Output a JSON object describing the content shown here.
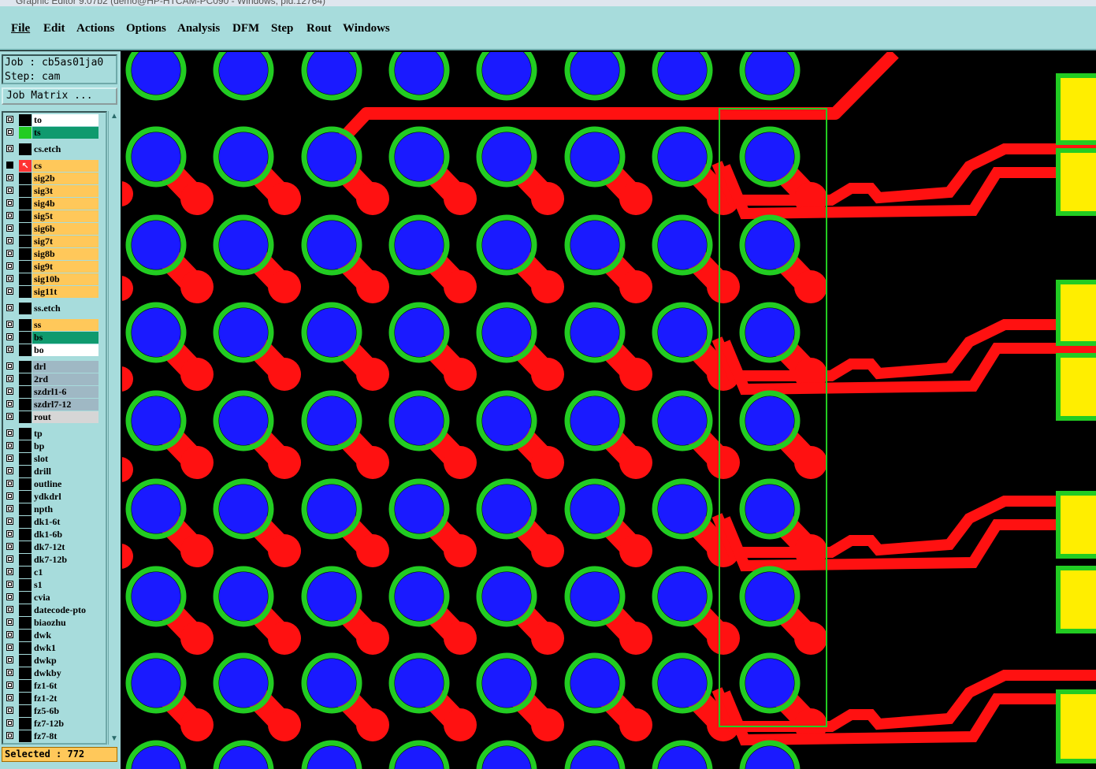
{
  "window": {
    "title": "Graphic Editor 9.07b2 (demo@HP-HTCAM-PC090 - Windows, pid:12764)"
  },
  "menu": [
    "File",
    "Edit",
    "Actions",
    "Options",
    "Analysis",
    "DFM",
    "Step",
    "Rout",
    "Windows"
  ],
  "job": {
    "line": "Job : cb5as01ja0",
    "step_line": "Step: cam",
    "matrix_button": "Job Matrix ..."
  },
  "layers": [
    {
      "name": "to",
      "color": "#ffffff",
      "swatch": "#000000"
    },
    {
      "name": "ts",
      "color": "#0f9a6e",
      "swatch": "#22cc22"
    },
    {
      "name": "cs.etch",
      "color": "#a7dcdc",
      "swatch": "#000000",
      "gap": true
    },
    {
      "name": "cs",
      "color": "#ffc85a",
      "swatch": "#ff3333",
      "active": true,
      "gap": true
    },
    {
      "name": "sig2b",
      "color": "#ffc85a",
      "swatch": "#000000"
    },
    {
      "name": "sig3t",
      "color": "#ffc85a",
      "swatch": "#000000"
    },
    {
      "name": "sig4b",
      "color": "#ffc85a",
      "swatch": "#000000"
    },
    {
      "name": "sig5t",
      "color": "#ffc85a",
      "swatch": "#000000"
    },
    {
      "name": "sig6b",
      "color": "#ffc85a",
      "swatch": "#000000"
    },
    {
      "name": "sig7t",
      "color": "#ffc85a",
      "swatch": "#000000"
    },
    {
      "name": "sig8b",
      "color": "#ffc85a",
      "swatch": "#000000"
    },
    {
      "name": "sig9t",
      "color": "#ffc85a",
      "swatch": "#000000"
    },
    {
      "name": "sig10b",
      "color": "#ffc85a",
      "swatch": "#000000"
    },
    {
      "name": "sig11t",
      "color": "#ffc85a",
      "swatch": "#000000"
    },
    {
      "name": "ss.etch",
      "color": "#a7dcdc",
      "swatch": "#000000",
      "gap": true
    },
    {
      "name": "ss",
      "color": "#ffc85a",
      "swatch": "#000000",
      "gap": true
    },
    {
      "name": "bs",
      "color": "#0f9a6e",
      "swatch": "#000000"
    },
    {
      "name": "bo",
      "color": "#ffffff",
      "swatch": "#000000"
    },
    {
      "name": "drl",
      "color": "#9fb8c4",
      "swatch": "#000000",
      "gap": true
    },
    {
      "name": "2rd",
      "color": "#9fb8c4",
      "swatch": "#000000"
    },
    {
      "name": "szdrl1-6",
      "color": "#9fb8c4",
      "swatch": "#000000"
    },
    {
      "name": "szdrl7-12",
      "color": "#9fb8c4",
      "swatch": "#000000"
    },
    {
      "name": "rout",
      "color": "#d6d6d6",
      "swatch": "#000000"
    },
    {
      "name": "tp",
      "color": "#a7dcdc",
      "swatch": "#000000",
      "gap": true
    },
    {
      "name": "bp",
      "color": "#a7dcdc",
      "swatch": "#000000"
    },
    {
      "name": "slot",
      "color": "#a7dcdc",
      "swatch": "#000000"
    },
    {
      "name": "drill",
      "color": "#a7dcdc",
      "swatch": "#000000"
    },
    {
      "name": "outline",
      "color": "#a7dcdc",
      "swatch": "#000000"
    },
    {
      "name": "ydkdrl",
      "color": "#a7dcdc",
      "swatch": "#000000"
    },
    {
      "name": "npth",
      "color": "#a7dcdc",
      "swatch": "#000000"
    },
    {
      "name": "dk1-6t",
      "color": "#a7dcdc",
      "swatch": "#000000"
    },
    {
      "name": "dk1-6b",
      "color": "#a7dcdc",
      "swatch": "#000000"
    },
    {
      "name": "dk7-12t",
      "color": "#a7dcdc",
      "swatch": "#000000"
    },
    {
      "name": "dk7-12b",
      "color": "#a7dcdc",
      "swatch": "#000000"
    },
    {
      "name": "c1",
      "color": "#a7dcdc",
      "swatch": "#000000"
    },
    {
      "name": "s1",
      "color": "#a7dcdc",
      "swatch": "#000000"
    },
    {
      "name": "cvia",
      "color": "#a7dcdc",
      "swatch": "#000000"
    },
    {
      "name": "datecode-pto",
      "color": "#a7dcdc",
      "swatch": "#000000"
    },
    {
      "name": "biaozhu",
      "color": "#a7dcdc",
      "swatch": "#000000"
    },
    {
      "name": "dwk",
      "color": "#a7dcdc",
      "swatch": "#000000"
    },
    {
      "name": "dwk1",
      "color": "#a7dcdc",
      "swatch": "#000000"
    },
    {
      "name": "dwkp",
      "color": "#a7dcdc",
      "swatch": "#000000"
    },
    {
      "name": "dwkby",
      "color": "#a7dcdc",
      "swatch": "#000000"
    },
    {
      "name": "fz1-6t",
      "color": "#a7dcdc",
      "swatch": "#000000"
    },
    {
      "name": "fz1-2t",
      "color": "#a7dcdc",
      "swatch": "#000000"
    },
    {
      "name": "fz5-6b",
      "color": "#a7dcdc",
      "swatch": "#000000"
    },
    {
      "name": "fz7-12b",
      "color": "#a7dcdc",
      "swatch": "#000000"
    },
    {
      "name": "fz7-8t",
      "color": "#a7dcdc",
      "swatch": "#000000"
    }
  ],
  "status": {
    "selected": "Selected : 772"
  },
  "colors": {
    "panel": "#a7dcdc",
    "pad": "#1a1aff",
    "ring": "#22cc22",
    "copper": "#ff1111",
    "smd": "#ffee00",
    "selection": "#22cc22"
  }
}
